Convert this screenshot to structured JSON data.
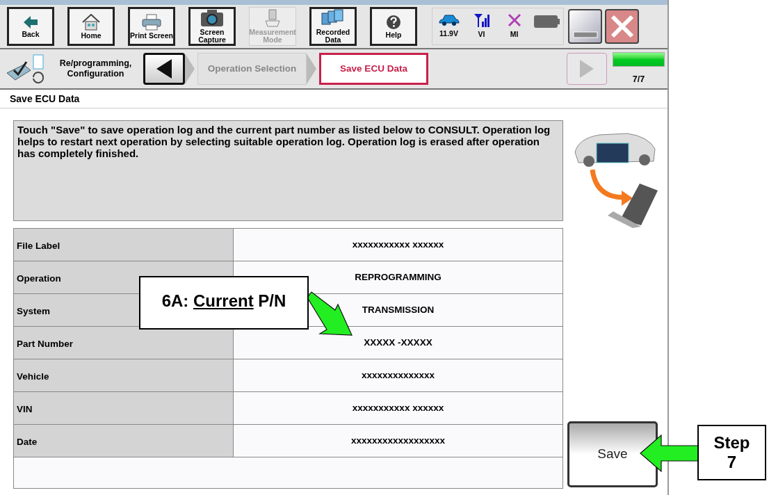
{
  "toolbar": {
    "buttons": [
      {
        "kind": "back",
        "label": "Back",
        "disabled": false
      },
      {
        "kind": "home",
        "label": "Home",
        "disabled": false
      },
      {
        "kind": "print",
        "label": "Print Screen",
        "disabled": false
      },
      {
        "kind": "camera",
        "label": "Screen Capture",
        "disabled": false
      },
      {
        "kind": "meter",
        "label": "Measurement Mode",
        "disabled": true
      },
      {
        "kind": "folders",
        "label": "Recorded Data",
        "disabled": false
      },
      {
        "kind": "help",
        "label": "Help",
        "disabled": false
      }
    ]
  },
  "status": {
    "items": [
      {
        "kind": "car",
        "label": "11.9V"
      },
      {
        "kind": "antenna",
        "label": "VI"
      },
      {
        "kind": "cross",
        "label": "MI"
      },
      {
        "kind": "battery"
      }
    ]
  },
  "breadcrumb": {
    "section": "Re/programming, Configuration",
    "steps": [
      {
        "label": "Operation Selection",
        "selected": false
      },
      {
        "label": "Save ECU Data",
        "selected": true
      }
    ],
    "next_disabled": true,
    "progress": {
      "level": 1,
      "label": "7/7"
    }
  },
  "page_title": "Save ECU Data",
  "message": "Touch \"Save\" to save operation log and the current part number as listed below to CONSULT. Operation log helps to restart next operation by selecting suitable operation log. Operation log is erased after operation has completely finished.",
  "table": {
    "rows": [
      {
        "label": "File Label",
        "value": "xxxxxxxxxxx xxxxxx"
      },
      {
        "label": "Operation",
        "value": "REPROGRAMMING"
      },
      {
        "label": "System",
        "value": "TRANSMISSION"
      },
      {
        "label": "Part Number",
        "value": "XXXXX -XXXXX"
      },
      {
        "label": "Vehicle",
        "value": "xxxxxxxxxxxxxx"
      },
      {
        "label": "VIN",
        "value": "xxxxxxxxxxx xxxxxx"
      },
      {
        "label": "Date",
        "value": "xxxxxxxxxxxxxxxxxx"
      }
    ]
  },
  "save_button": "Save",
  "annotations": [
    {
      "kind": "callout",
      "prefix": "6A:",
      "underlined": "Current",
      "suffix": "P/N"
    },
    {
      "kind": "step",
      "label": "Step 7"
    }
  ]
}
